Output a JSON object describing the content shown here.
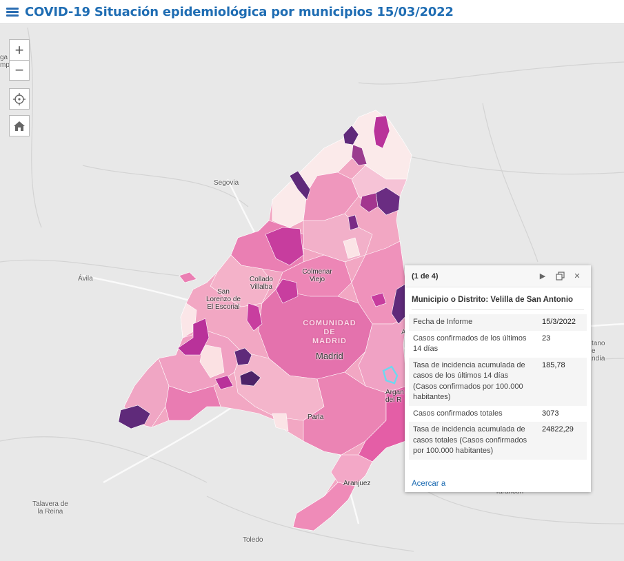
{
  "header": {
    "title": "COVID-19 Situación epidemiológica por municipios 15/03/2022"
  },
  "controls": {
    "zoom_in": "+",
    "zoom_out": "−"
  },
  "map_labels": {
    "top_left": "ga del\nmpo",
    "segovia": "Segovia",
    "avila": "Ávila",
    "san_lorenzo": "San\nLorenzo de\nEl Escorial",
    "collado": "Collado\nVillalba",
    "colmenar": "Colmenar\nViejo",
    "comunidad": "COMUNIDAD\nDE\nMADRID",
    "madrid": "Madrid",
    "parla": "Parla",
    "arganda": "Argan\ndel R",
    "aranjuez": "Aranjuez",
    "talavera": "Talavera de\nla Reina",
    "toledo": "Toledo",
    "tarancon": "Tarancón",
    "right_1": "tano",
    "right_2": "e",
    "right_3": "ndía",
    "right_4": "A"
  },
  "popup": {
    "count": "(1 de 4)",
    "title": "Municipio o Distrito: Velilla de San Antonio",
    "rows": [
      {
        "label": "Fecha de Informe",
        "value": "15/3/2022"
      },
      {
        "label": "Casos confirmados de los últimos 14 días",
        "value": "23"
      },
      {
        "label": "Tasa de incidencia acumulada de casos de los últimos 14 días (Casos confirmados por 100.000 habitantes)",
        "value": "185,78"
      },
      {
        "label": "Casos confirmados totales",
        "value": "3073"
      },
      {
        "label": "Tasa de incidencia acumulada de casos totales (Casos confirmados por 100.000 habitantes)",
        "value": "24822,29"
      }
    ],
    "zoom_link": "Acercar a"
  },
  "colors": {
    "header_title": "#1f6db3",
    "very_light": "#fdf0f0",
    "light": "#f7bccb",
    "mid": "#ee8ab6",
    "strong": "#e062a6",
    "magenta": "#b9329a",
    "dark": "#5f2a7a",
    "highlight": "#6fd7ef"
  }
}
